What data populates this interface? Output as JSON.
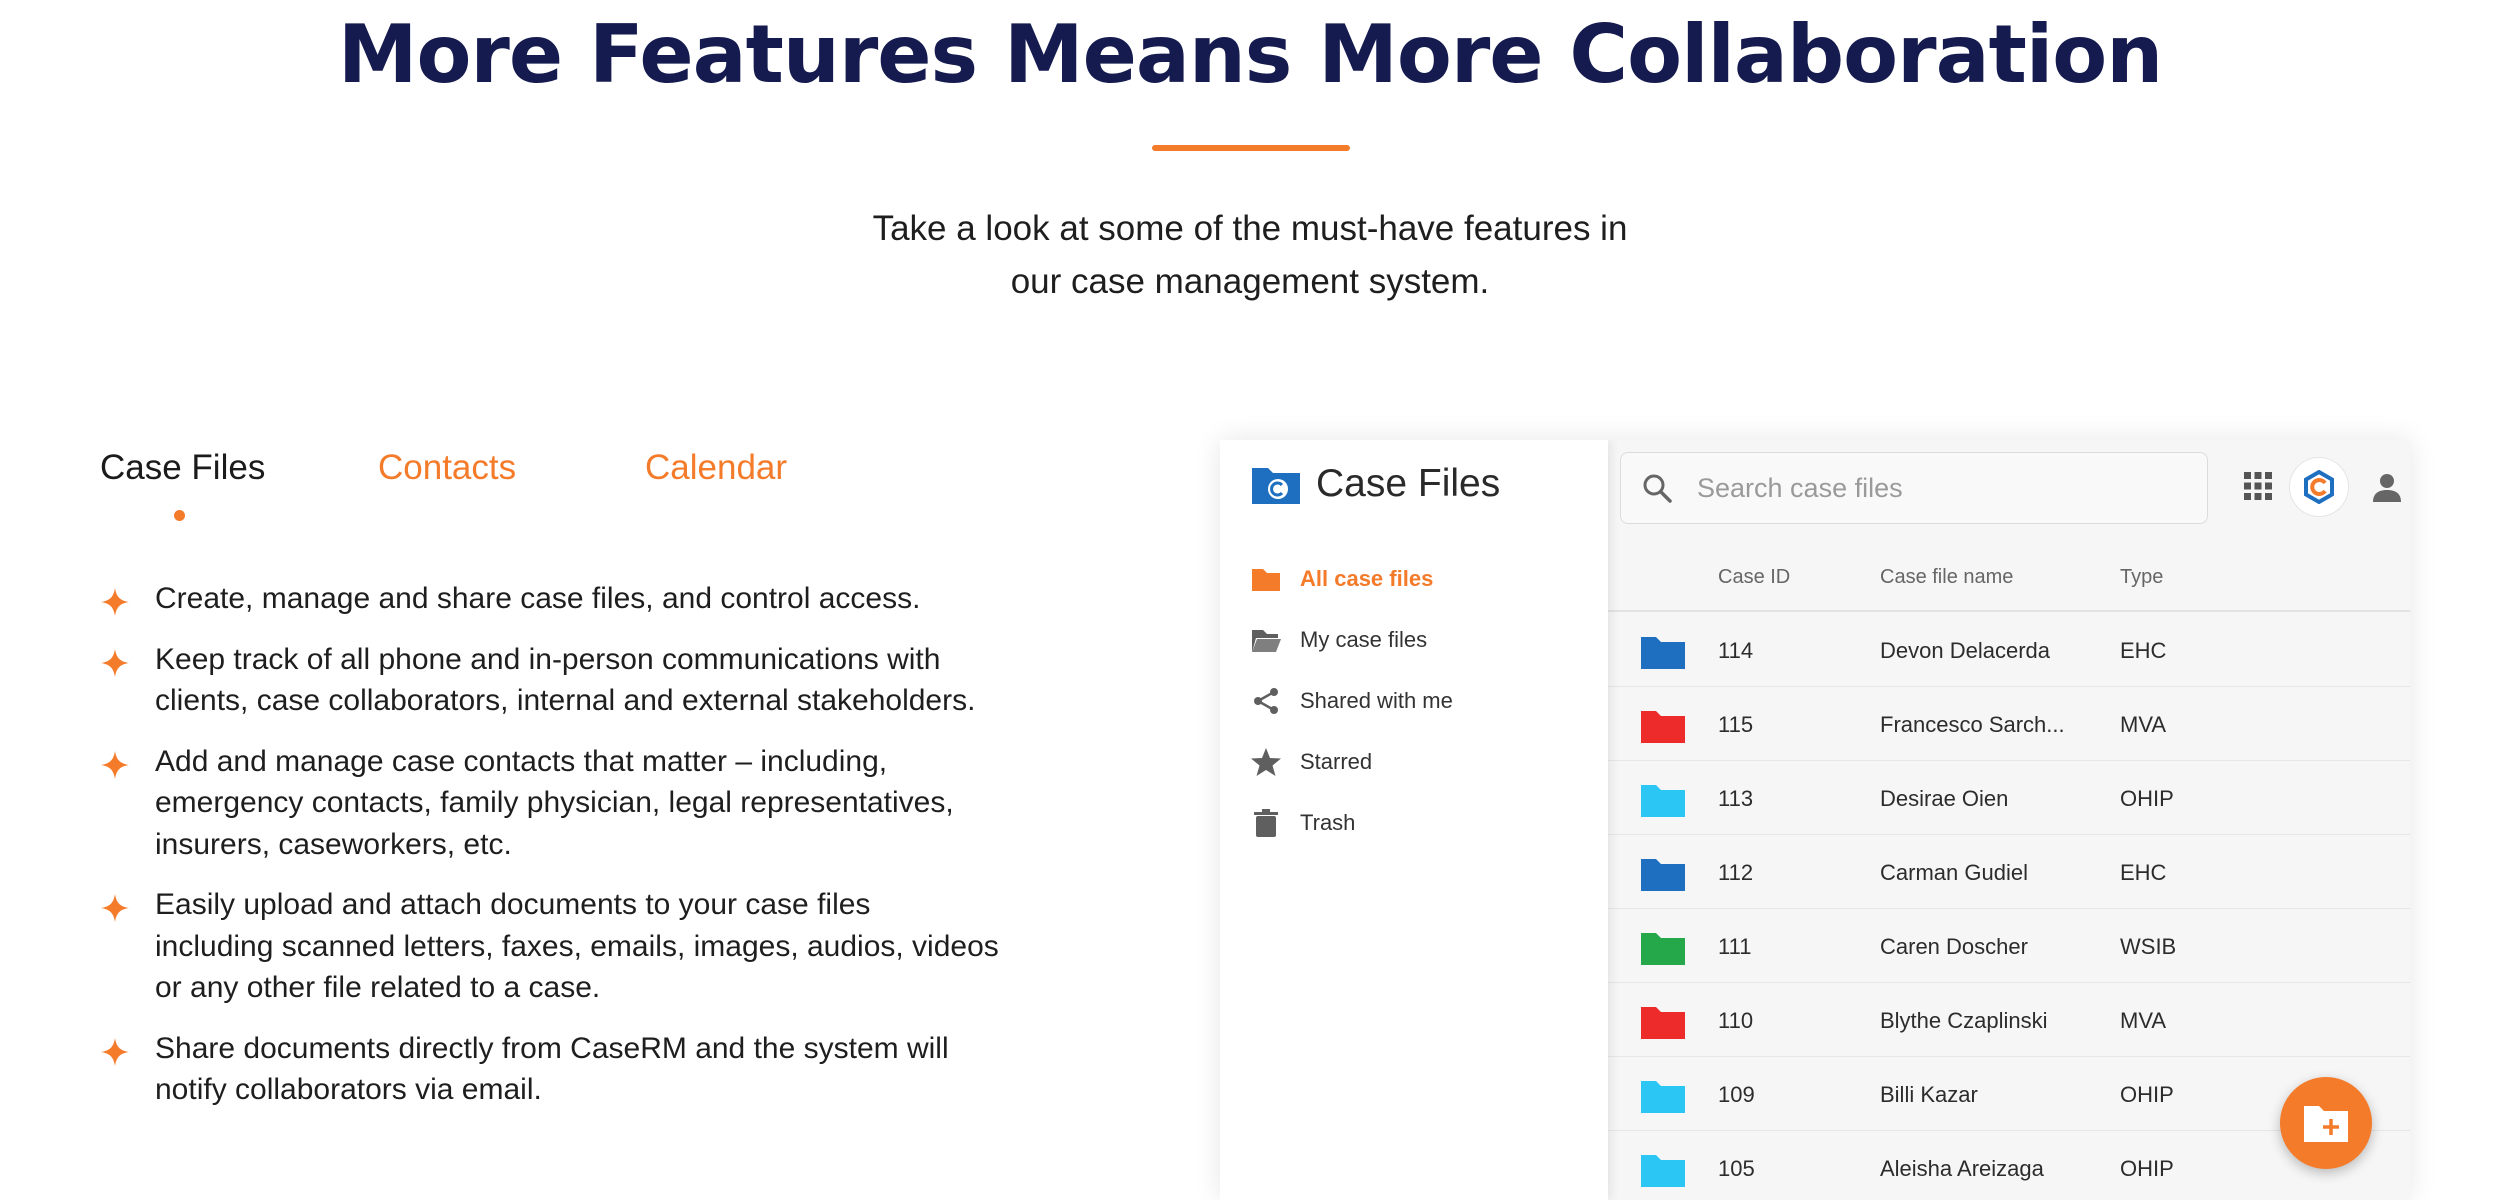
{
  "hero": {
    "headline": "More Features Means More Collaboration",
    "subtitle_line1": "Take a look at some of the must-have features in",
    "subtitle_line2": "our case management system."
  },
  "tabs": [
    {
      "label": "Case Files",
      "active": true
    },
    {
      "label": "Contacts",
      "active": false
    },
    {
      "label": "Calendar",
      "active": false
    }
  ],
  "features": [
    [
      "Create, manage and share case files, and control access."
    ],
    [
      "Keep track of all phone and in-person communications with",
      "clients, case collaborators, internal and external stakeholders."
    ],
    [
      "Add and manage case contacts that matter – including,",
      "emergency contacts, family physician, legal representatives,",
      "insurers, caseworkers, etc."
    ],
    [
      "Easily upload and attach documents to your case files",
      "including scanned letters, faxes, emails, images, audios, videos",
      "or any other file related to a case."
    ],
    [
      "Share documents directly from CaseRM and the system will",
      "notify collaborators via email."
    ]
  ],
  "app": {
    "title": "Case Files",
    "nav": [
      {
        "label": "All case files",
        "icon": "folder-icon",
        "active": true
      },
      {
        "label": "My case files",
        "icon": "open-folder-icon",
        "active": false
      },
      {
        "label": "Shared with me",
        "icon": "share-icon",
        "active": false
      },
      {
        "label": "Starred",
        "icon": "star-icon",
        "active": false
      },
      {
        "label": "Trash",
        "icon": "trash-icon",
        "active": false
      }
    ],
    "search_placeholder": "Search case files",
    "columns": [
      "Case ID",
      "Case file name",
      "Type"
    ],
    "rows": [
      {
        "id": "114",
        "name": "Devon Delacerda",
        "type": "EHC",
        "color": "#1e6fc0"
      },
      {
        "id": "115",
        "name": "Francesco Sarch...",
        "type": "MVA",
        "color": "#ee2b2b"
      },
      {
        "id": "113",
        "name": "Desirae Oien",
        "type": "OHIP",
        "color": "#2cc6f4"
      },
      {
        "id": "112",
        "name": "Carman Gudiel",
        "type": "EHC",
        "color": "#1e6fc0"
      },
      {
        "id": "111",
        "name": "Caren Doscher",
        "type": "WSIB",
        "color": "#25a84a"
      },
      {
        "id": "110",
        "name": "Blythe Czaplinski",
        "type": "MVA",
        "color": "#ee2b2b"
      },
      {
        "id": "109",
        "name": "Billi Kazar",
        "type": "OHIP",
        "color": "#2cc6f4"
      },
      {
        "id": "105",
        "name": "Aleisha Areizaga",
        "type": "OHIP",
        "color": "#2cc6f4"
      }
    ]
  },
  "colors": {
    "accent": "#f47b2a",
    "headline": "#151a4f",
    "logo_blue": "#1e6fc0"
  }
}
